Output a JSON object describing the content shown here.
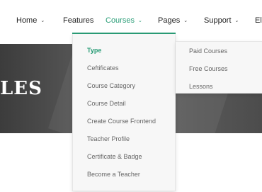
{
  "nav": {
    "items": [
      {
        "label": "Home",
        "has_chevron": true
      },
      {
        "label": "Features",
        "has_chevron": false
      },
      {
        "label": "Courses",
        "has_chevron": true,
        "active": true
      },
      {
        "label": "Pages",
        "has_chevron": true
      },
      {
        "label": "Support",
        "has_chevron": true
      },
      {
        "label": "El",
        "has_chevron": false
      }
    ],
    "chevron": "⌄"
  },
  "hero": {
    "title": "LES"
  },
  "courses_menu": {
    "items": [
      {
        "label": "Type",
        "active": true
      },
      {
        "label": "Ceftificates"
      },
      {
        "label": "Course Category"
      },
      {
        "label": "Course Detail"
      },
      {
        "label": "Create Course Frontend"
      },
      {
        "label": "Teacher Profile"
      },
      {
        "label": "Certificate & Badge"
      },
      {
        "label": "Become a Teacher"
      }
    ],
    "submenu_arrow": "›"
  },
  "type_submenu": {
    "items": [
      {
        "label": "Paid Courses"
      },
      {
        "label": "Free Courses"
      },
      {
        "label": "Lessons"
      }
    ]
  },
  "colors": {
    "accent": "#2a9d77",
    "text": "#222222",
    "muted": "#666666",
    "menu_bg": "#f7f7f7"
  }
}
